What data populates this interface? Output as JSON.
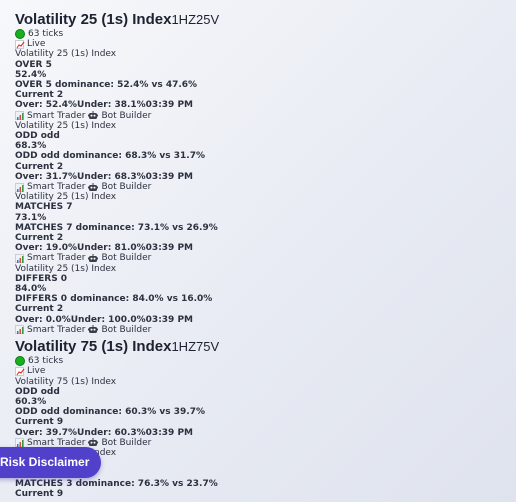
{
  "sections": [
    {
      "title": "Volatility 25 (1s) Index",
      "code": "1HZ25V",
      "ticks": "63 ticks",
      "live": "Live",
      "cards": [
        {
          "market": "Volatility 25 (1s) Index",
          "label": "OVER 5",
          "percent": "52.4%",
          "dominance": "OVER 5 dominance: 52.4% vs 47.6%",
          "current": "Current 2",
          "stats": "Over: 52.4%Under: 38.1%03:39 PM",
          "smart": "Smart Trader",
          "bot": "Bot Builder"
        },
        {
          "market": "Volatility 25 (1s) Index",
          "label": "ODD odd",
          "percent": "68.3%",
          "dominance": "ODD odd dominance: 68.3% vs 31.7%",
          "current": "Current 2",
          "stats": "Over: 31.7%Under: 68.3%03:39 PM",
          "smart": "Smart Trader",
          "bot": "Bot Builder"
        },
        {
          "market": "Volatility 25 (1s) Index",
          "label": "MATCHES 7",
          "percent": "73.1%",
          "dominance": "MATCHES 7 dominance: 73.1% vs 26.9%",
          "current": "Current 2",
          "stats": "Over: 19.0%Under: 81.0%03:39 PM",
          "smart": "Smart Trader",
          "bot": "Bot Builder"
        },
        {
          "market": "Volatility 25 (1s) Index",
          "label": "DIFFERS 0",
          "percent": "84.0%",
          "dominance": "DIFFERS 0 dominance: 84.0% vs 16.0%",
          "current": "Current 2",
          "stats": "Over: 0.0%Under: 100.0%03:39 PM",
          "smart": "Smart Trader",
          "bot": "Bot Builder"
        }
      ]
    },
    {
      "title": "Volatility 75 (1s) Index",
      "code": "1HZ75V",
      "ticks": "63 ticks",
      "live": "Live",
      "cards": [
        {
          "market": "Volatility 75 (1s) Index",
          "label": "ODD odd",
          "percent": "60.3%",
          "dominance": "ODD odd dominance: 60.3% vs 39.7%",
          "current": "Current 9",
          "stats": "Over: 39.7%Under: 60.3%03:39 PM",
          "smart": "Smart Trader",
          "bot": "Bot Builder"
        },
        {
          "market": "Volatility 75 (1s) Index",
          "label": "MATCHES 3",
          "percent": "76.3%",
          "dominance": "MATCHES 3 dominance: 76.3% vs 23.7%",
          "current": "Current 9",
          "stats": "",
          "smart": "",
          "bot": ""
        }
      ]
    }
  ],
  "disclaimer": "Risk Disclaimer",
  "colors": {
    "live_dot": "#18b021",
    "disclaimer_bg": "#5140c9"
  },
  "icons": [
    "green-dot-icon",
    "chart-increasing-icon",
    "bar-chart-icon",
    "robot-face-icon"
  ]
}
